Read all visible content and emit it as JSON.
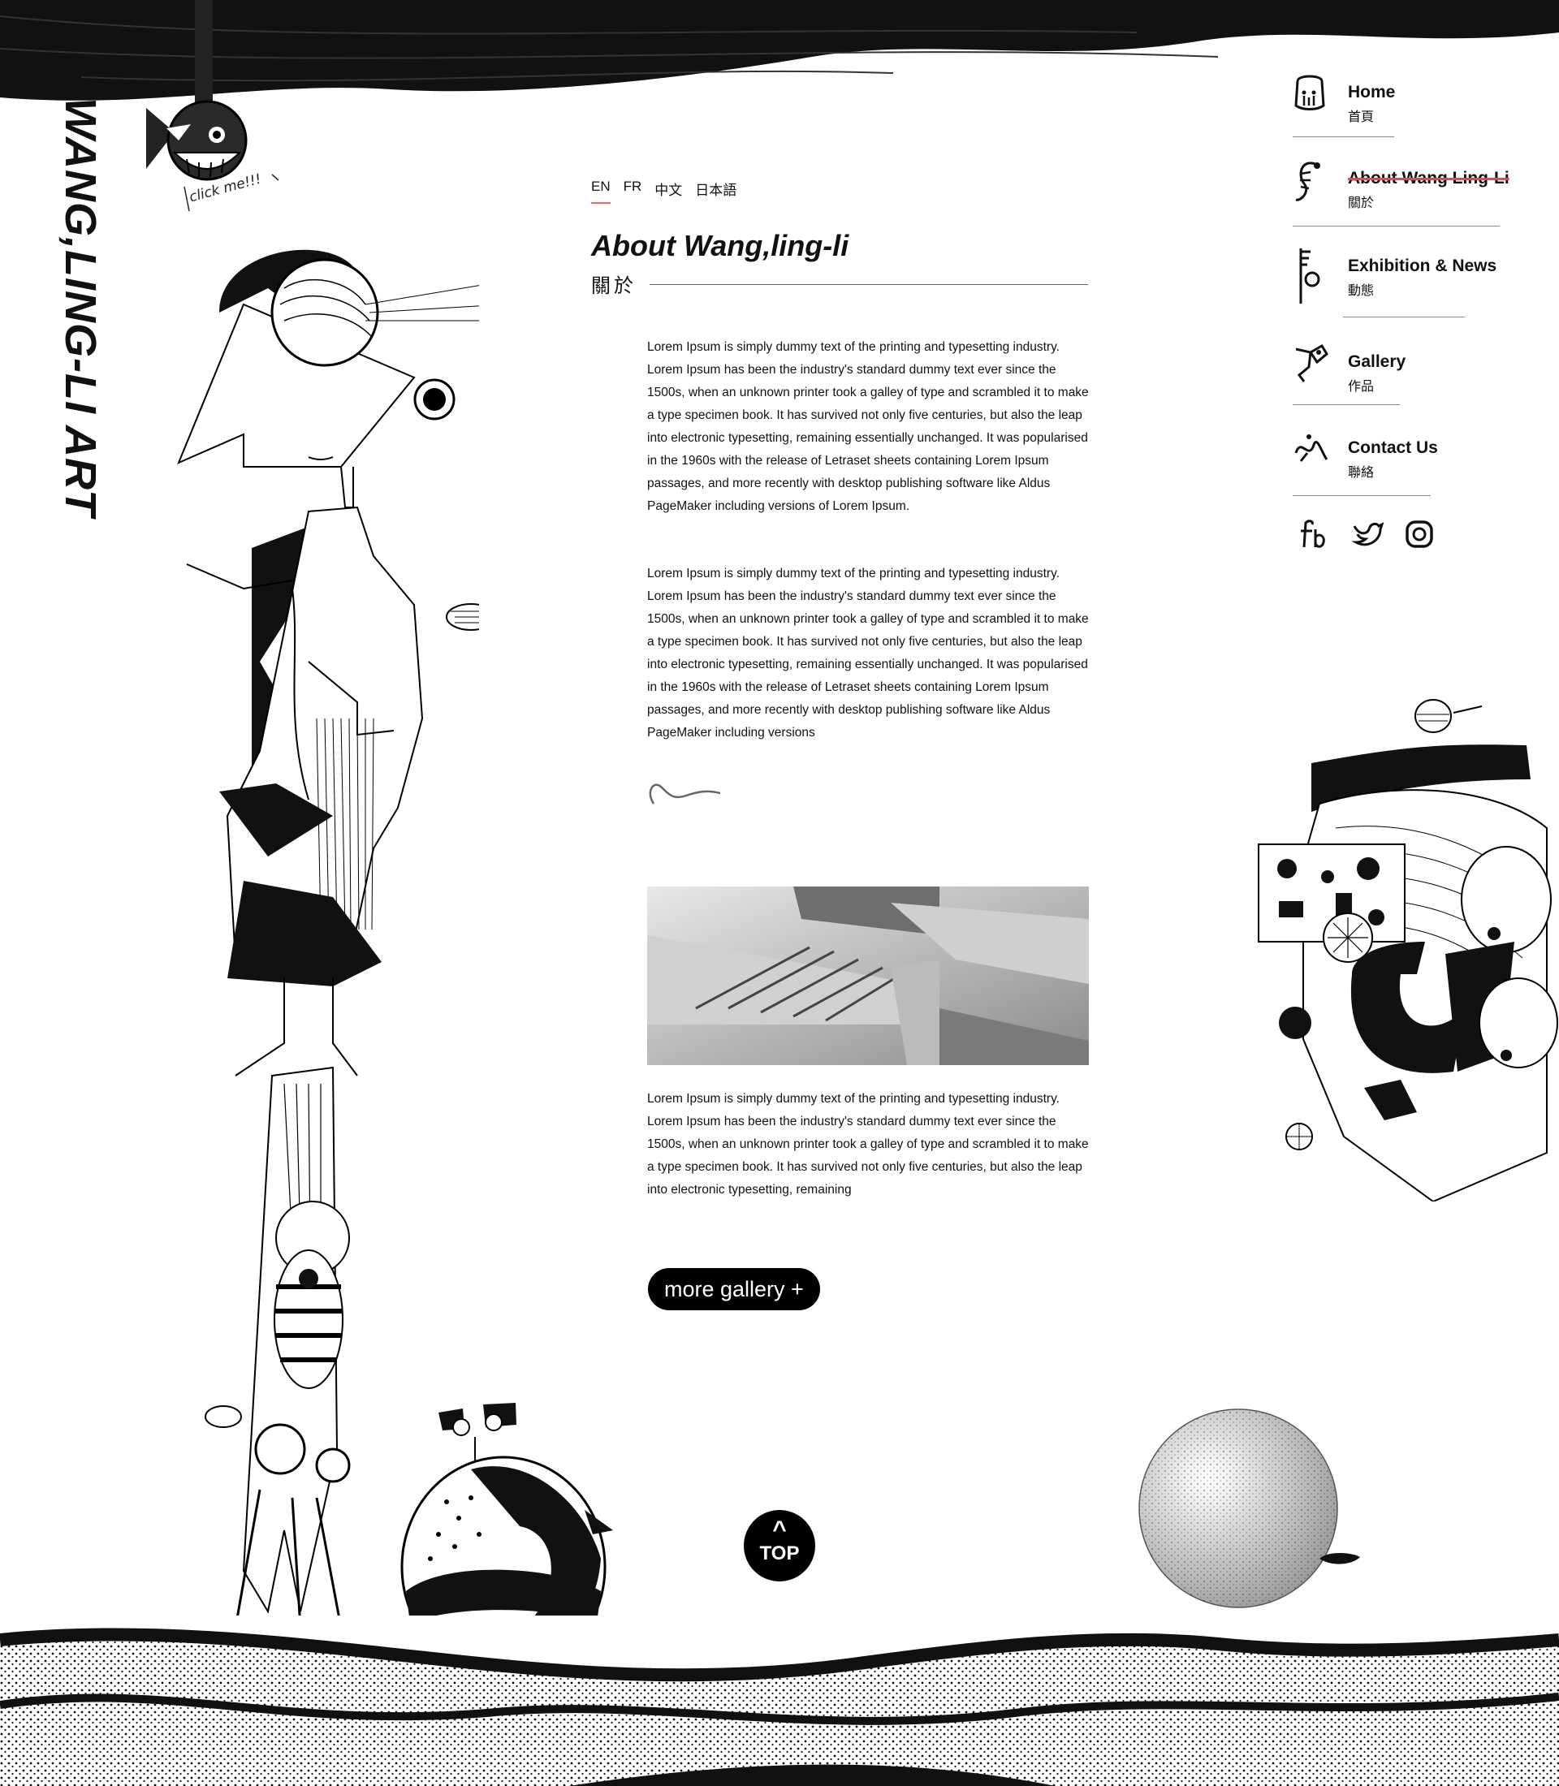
{
  "brand": {
    "logo_text": "WANG,LING-LI ART"
  },
  "fish": {
    "label": "click me!!!"
  },
  "languages": [
    {
      "label": "EN",
      "active": true
    },
    {
      "label": "FR"
    },
    {
      "label": "中文"
    },
    {
      "label": "日本語"
    }
  ],
  "about": {
    "title": "About Wang,ling-li",
    "title_zh": "關於"
  },
  "content": {
    "paragraphs": [
      "Lorem Ipsum is simply dummy text of the printing and typesetting industry. Lorem Ipsum has been the industry's standard dummy text ever since the 1500s, when an unknown printer took a galley of type and scrambled it to make a type specimen book. It has survived not only five centuries, but also the leap into electronic typesetting, remaining essentially unchanged. It was popularised in the 1960s with the release of Letraset sheets containing Lorem Ipsum passages, and more recently with desktop publishing software like Aldus PageMaker including versions of Lorem Ipsum.",
      "Lorem Ipsum is simply dummy text of the printing and typesetting industry. Lorem Ipsum has been the industry's standard dummy text ever since the 1500s, when an unknown printer took a galley of type and scrambled it to make a type specimen book. It has survived not only five centuries, but also the leap into electronic typesetting, remaining essentially unchanged. It was popularised in the 1960s with the release of Letraset sheets containing Lorem Ipsum passages, and more recently with desktop publishing software like Aldus PageMaker including versions",
      "Lorem Ipsum is simply dummy text of the printing and typesetting industry. Lorem Ipsum has been the industry's standard dummy text ever since the 1500s, when an unknown printer took a galley of type and scrambled it to make a type specimen book. It has survived not only five centuries, but also the leap into electronic typesetting, remaining"
    ]
  },
  "more_gallery": {
    "label": "more gallery +"
  },
  "top_button": {
    "caret": "^",
    "label": "TOP"
  },
  "nav": [
    {
      "en": "Home",
      "zh": "首頁",
      "icon": "face-icon"
    },
    {
      "en": "About Wang Ling-Li",
      "zh": "關於",
      "icon": "worm-icon",
      "active": true
    },
    {
      "en": "Exhibition & News",
      "zh": "動態",
      "icon": "key-icon"
    },
    {
      "en": "Gallery",
      "zh": "作品",
      "icon": "creature-icon"
    },
    {
      "en": "Contact Us",
      "zh": "聯絡",
      "icon": "squiggle-creature-icon"
    }
  ],
  "social": [
    {
      "name": "facebook",
      "icon": "facebook-icon"
    },
    {
      "name": "twitter",
      "icon": "twitter-icon"
    },
    {
      "name": "instagram",
      "icon": "instagram-icon"
    }
  ],
  "colors": {
    "ink": "#111111",
    "accent": "#e04a55",
    "paper": "#ffffff"
  }
}
